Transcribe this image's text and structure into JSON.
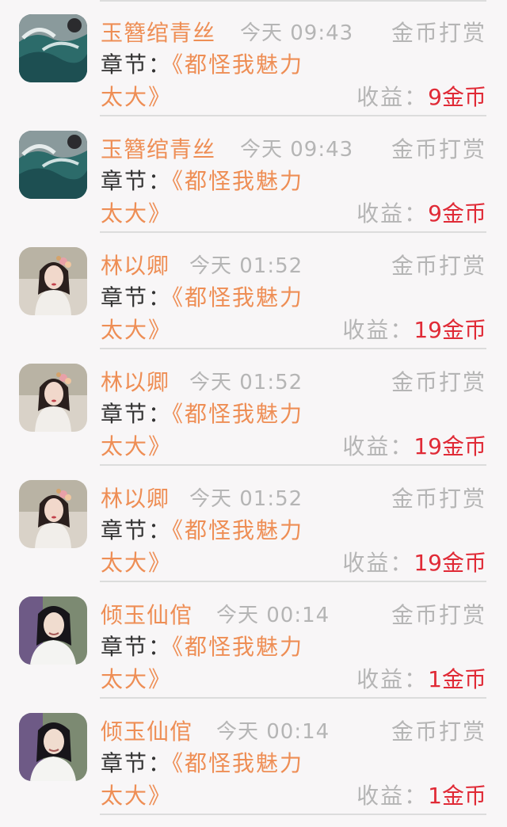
{
  "records": [
    {
      "name": "玉簪绾青丝",
      "time": "今天 09:43",
      "type": "金币打赏",
      "chapter_label": "章节：",
      "chapter_title_line1": "《都怪我魅力",
      "chapter_title_line2": "太大》",
      "income_label": "收益：",
      "income_value": "9金币",
      "avatar_icon": "avatar-landscape-waves"
    },
    {
      "name": "玉簪绾青丝",
      "time": "今天 09:43",
      "type": "金币打赏",
      "chapter_label": "章节：",
      "chapter_title_line1": "《都怪我魅力",
      "chapter_title_line2": "太大》",
      "income_label": "收益：",
      "income_value": "9金币",
      "avatar_icon": "avatar-landscape-waves"
    },
    {
      "name": "林以卿",
      "time": "今天 01:52",
      "type": "金币打赏",
      "chapter_label": "章节：",
      "chapter_title_line1": "《都怪我魅力",
      "chapter_title_line2": "太大》",
      "income_label": "收益：",
      "income_value": "19金币",
      "avatar_icon": "avatar-woman-hanfu"
    },
    {
      "name": "林以卿",
      "time": "今天 01:52",
      "type": "金币打赏",
      "chapter_label": "章节：",
      "chapter_title_line1": "《都怪我魅力",
      "chapter_title_line2": "太大》",
      "income_label": "收益：",
      "income_value": "19金币",
      "avatar_icon": "avatar-woman-hanfu"
    },
    {
      "name": "林以卿",
      "time": "今天 01:52",
      "type": "金币打赏",
      "chapter_label": "章节：",
      "chapter_title_line1": "《都怪我魅力",
      "chapter_title_line2": "太大》",
      "income_label": "收益：",
      "income_value": "19金币",
      "avatar_icon": "avatar-woman-hanfu"
    },
    {
      "name": "倾玉仙倌",
      "time": "今天 00:14",
      "type": "金币打赏",
      "chapter_label": "章节：",
      "chapter_title_line1": "《都怪我魅力",
      "chapter_title_line2": "太大》",
      "income_label": "收益：",
      "income_value": "1金币",
      "avatar_icon": "avatar-man-white-robe"
    },
    {
      "name": "倾玉仙倌",
      "time": "今天 00:14",
      "type": "金币打赏",
      "chapter_label": "章节：",
      "chapter_title_line1": "《都怪我魅力",
      "chapter_title_line2": "太大》",
      "income_label": "收益：",
      "income_value": "1金币",
      "avatar_icon": "avatar-man-white-robe"
    }
  ],
  "colors": {
    "name_accent": "#ee8e55",
    "income_red": "#e02a36",
    "muted_gray": "#b5b5b5",
    "label_dark": "#333333",
    "background": "#f8f6f7"
  }
}
